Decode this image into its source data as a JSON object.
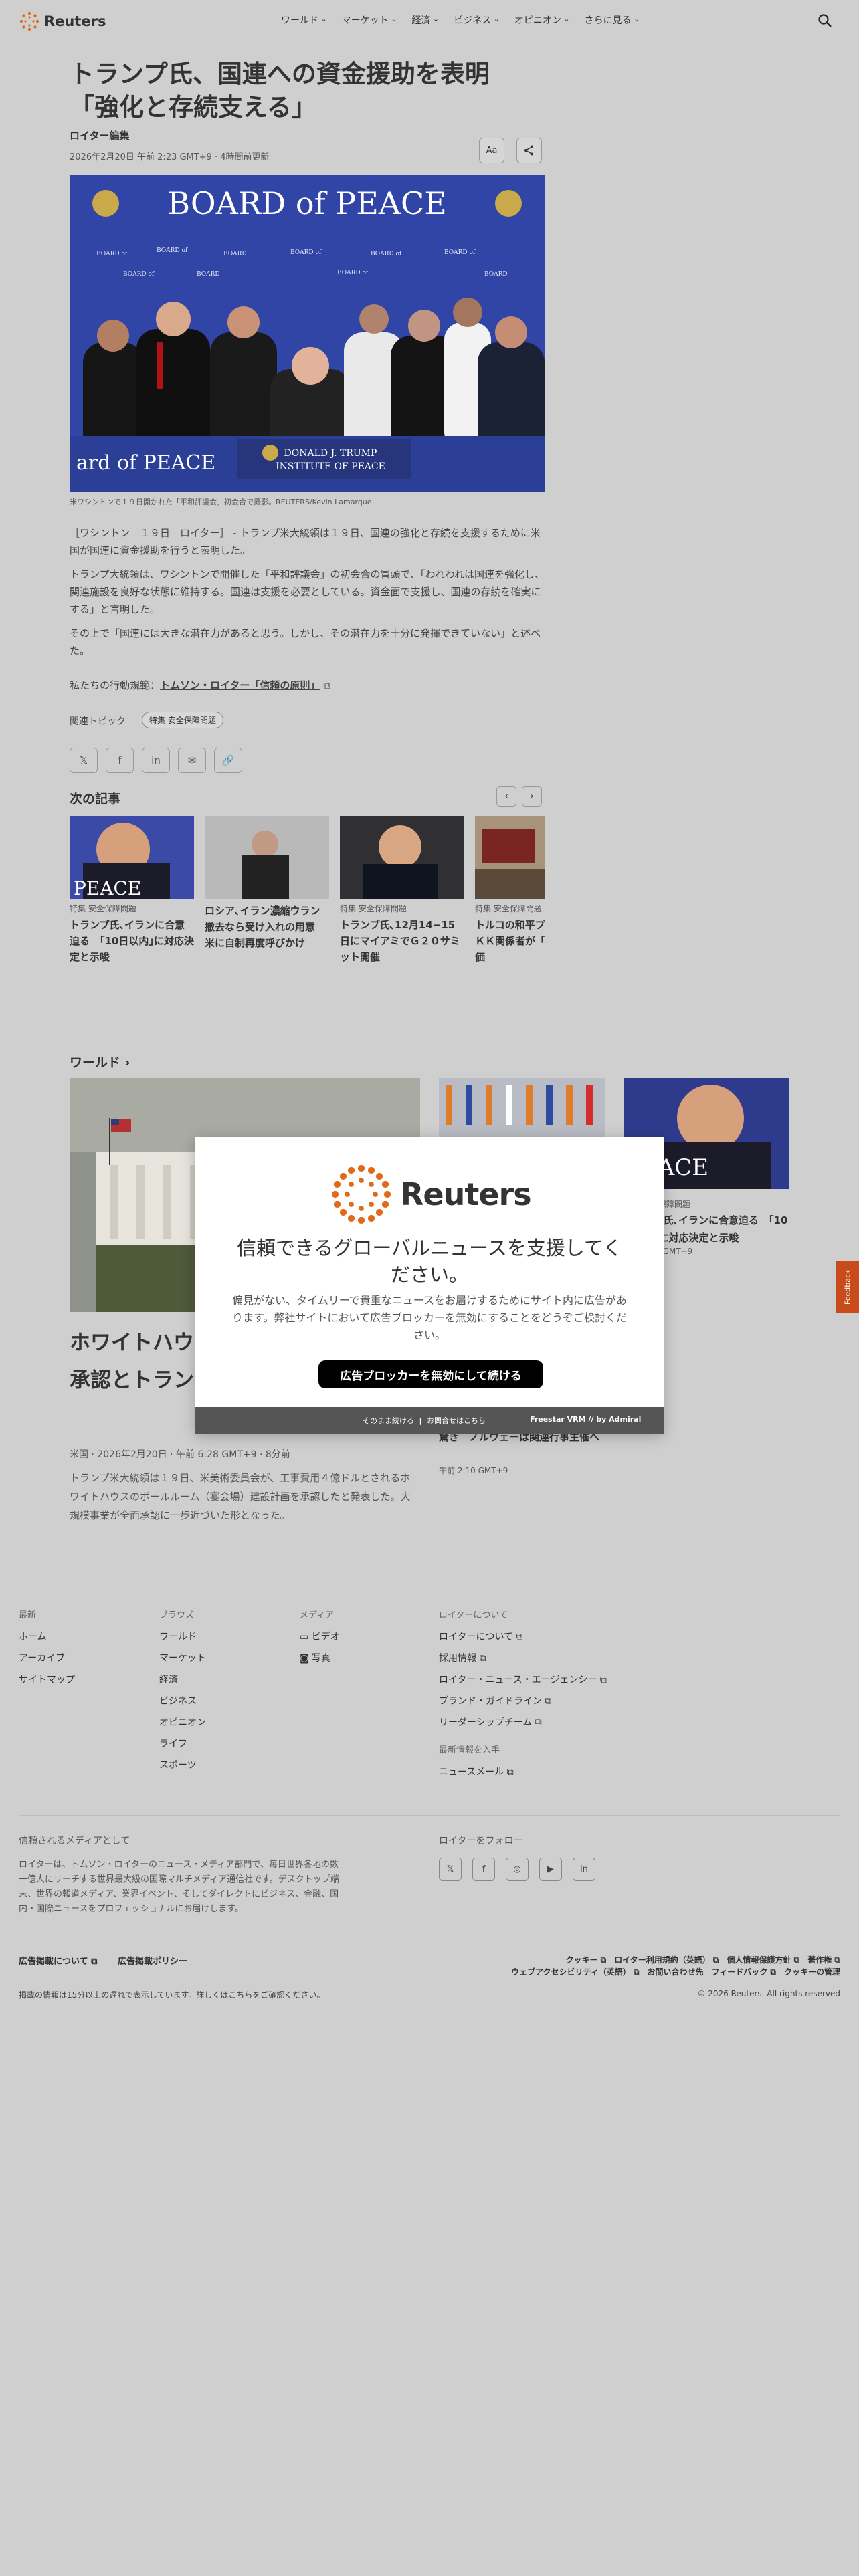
{
  "header": {
    "brand": "Reuters",
    "nav": [
      "ワールド",
      "マーケット",
      "経済",
      "ビジネス",
      "オピニオン",
      "さらに見る"
    ]
  },
  "article": {
    "title": "トランプ氏、国連への資金援助を表明　「強化と存続支える」",
    "byline": "ロイター編集",
    "date": "2026年2月20日 午前 2:23 GMT+9 · 4時間前更新",
    "font_button": "Aa",
    "caption": "米ワシントンで１９日開かれた「平和評議会」初会合で撮影。REUTERS/Kevin Lamarque",
    "hero_banner": "BOARD of PEACE",
    "hero_podium": "ard of PEACE",
    "hero_nameplate": "DONALD J. TRUMP\nINSTITUTE OF PEACE",
    "paragraphs": [
      "［ワシントン　１９日　ロイター］ - トランプ米大統領は１９日、国連の強化と存続を支援するために米国が国連に資金援助を行うと表明した。",
      "トランプ大統領は、ワシントンで開催した「平和評議会」の初会合の冒頭で、「われわれは国連を強化し、関連施設を良好な状態に維持する。国連は支援を必要としている。資金面で支援し、国連の存続を確実にする」と言明した。",
      "その上で「国連には大きな潜在力があると思う。しかし、その潜在力を十分に発揮できていない」と述べた。"
    ],
    "principle_prefix": "私たちの行動規範：",
    "principle_link": "トムソン・ロイター「信頼の原則」",
    "topic_label": "関連トピック",
    "topic_chip": "特集 安全保障問題"
  },
  "share": {
    "x": "𝕏",
    "facebook": "f",
    "linkedin": "in",
    "email": "✉",
    "link": "🔗"
  },
  "next_articles": {
    "heading": "次の記事",
    "prev": "‹",
    "next": "›",
    "items": [
      {
        "kicker": "特集 安全保障問題",
        "title": "トランプ氏､イランに合意迫る　｢10日以内｣に対応決定と示唆",
        "img_text": "PEACE"
      },
      {
        "kicker": "",
        "title": "ロシア､イラン濃縮ウラン撤去なら受け入れの用意　米に自制再度呼びかけ",
        "img_text": ""
      },
      {
        "kicker": "特集 安全保障問題",
        "title": "トランプ氏､12月14−15日にマイアミでＧ２０サミット開催",
        "img_text": ""
      },
      {
        "kicker": "特集 安全保障問題",
        "title": "トルコの和平プロセス、ＰＫＫ関係者が「一歩」と評価",
        "img_text": ""
      }
    ]
  },
  "world": {
    "heading": "ワールド ›",
    "main_title": "ホワイトハウス宴会場、米委員会が承認とトランプ氏 工事続くも",
    "main_meta": "米国 · 2026年2月20日 · 午前 6:28 GMT+9 · 8分前",
    "main_desc": "トランプ米大統領は１９日、米美術委員会が、工事費用４億ドルとされるホワイトハウスのボールルーム（宴会場）建設計画を承認したと発表した。大規模事業が全面承認に一歩近づいた形となった。",
    "side2_kicker": "特集 安全保障問題",
    "side2_title": "トランプ氏､イランに合意迫る　｢10日以内｣に対応決定と示唆",
    "side2_date": "午前 2:10 GMT+9",
    "side2_img_text": "PEACE",
    "side3_title": "驚き　ノルウェーは関連行事主催へ",
    "side3_date": "午前 2:10 GMT+9"
  },
  "feedback": "Feedback",
  "modal": {
    "brand": "Reuters",
    "headline": "信頼できるグローバルニュースを支援してください。",
    "body": "偏見がない、タイムリーで貴重なニュースをお届けするためにサイト内に広告があります。弊社サイトにおいて広告ブロッカーを無効にすることをどうぞご検討ください。",
    "button": "広告ブロッカーを無効にして続ける",
    "link_continue": "そのまま続ける",
    "link_sep": "|",
    "link_contact": "お問合せはこちら",
    "powered": "Freestar VRM // by Admiral"
  },
  "footer": {
    "latest": {
      "heading": "最新",
      "items": [
        "ホーム",
        "アーカイブ",
        "サイトマップ"
      ]
    },
    "browse": {
      "heading": "ブラウズ",
      "items": [
        "ワールド",
        "マーケット",
        "経済",
        "ビジネス",
        "オピニオン",
        "ライフ",
        "スポーツ"
      ]
    },
    "media": {
      "heading": "メディア",
      "items": [
        "ビデオ",
        "写真"
      ]
    },
    "about": {
      "heading": "ロイターについて",
      "items": [
        "ロイターについて",
        "採用情報",
        "ロイター・ニュース・エージェンシー",
        "ブランド・ガイドライン",
        "リーダーシップチーム"
      ]
    },
    "latest_info": {
      "heading": "最新情報を入手",
      "items": [
        "ニュースメール"
      ]
    },
    "trusted_heading": "信頼されるメディアとして",
    "trusted_text": "ロイターは、トムソン・ロイターのニュース・メディア部門で、毎日世界各地の数十億人にリーチする世界最大級の国際マルチメディア通信社です。デスクトップ端末、世界の報道メディア、業界イベント、そしてダイレクトにビジネス、金融、国内・国際ニュースをプロフェッショナルにお届けします。",
    "follow_heading": "ロイターをフォロー",
    "social": [
      "𝕏",
      "f",
      "◎",
      "▶",
      "in"
    ],
    "ad_about": "広告掲載について",
    "ad_policy": "広告掲載ポリシー",
    "legal_line1": "クッキー ⧉　ロイター利用規約（英語） ⧉　個人情報保護方針 ⧉　著作権 ⧉",
    "legal_line2": "ウェブアクセシビリティ（英語） ⧉　お問い合わせ先　フィードバック ⧉　クッキーの管理",
    "delay_note": "掲載の情報は15分以上の遅れで表示しています。詳しくはこちらをご確認ください。",
    "copyright": "© 2026 Reuters. All rights reserved"
  }
}
